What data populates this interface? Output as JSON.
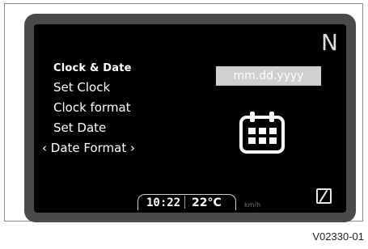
{
  "screen": {
    "gear_indicator": "N",
    "menu": {
      "title": "Clock & Date",
      "items": [
        {
          "label": "Set Clock"
        },
        {
          "label": "Clock format"
        },
        {
          "label": "Set Date"
        },
        {
          "label": "‹ Date Format ›"
        }
      ]
    },
    "date_format_value": "mm.dd.yyyy",
    "status_bar": {
      "time": "10:22",
      "temperature": "22°C",
      "speed_unit": "km/h"
    }
  },
  "figure_code": "V02330-01"
}
